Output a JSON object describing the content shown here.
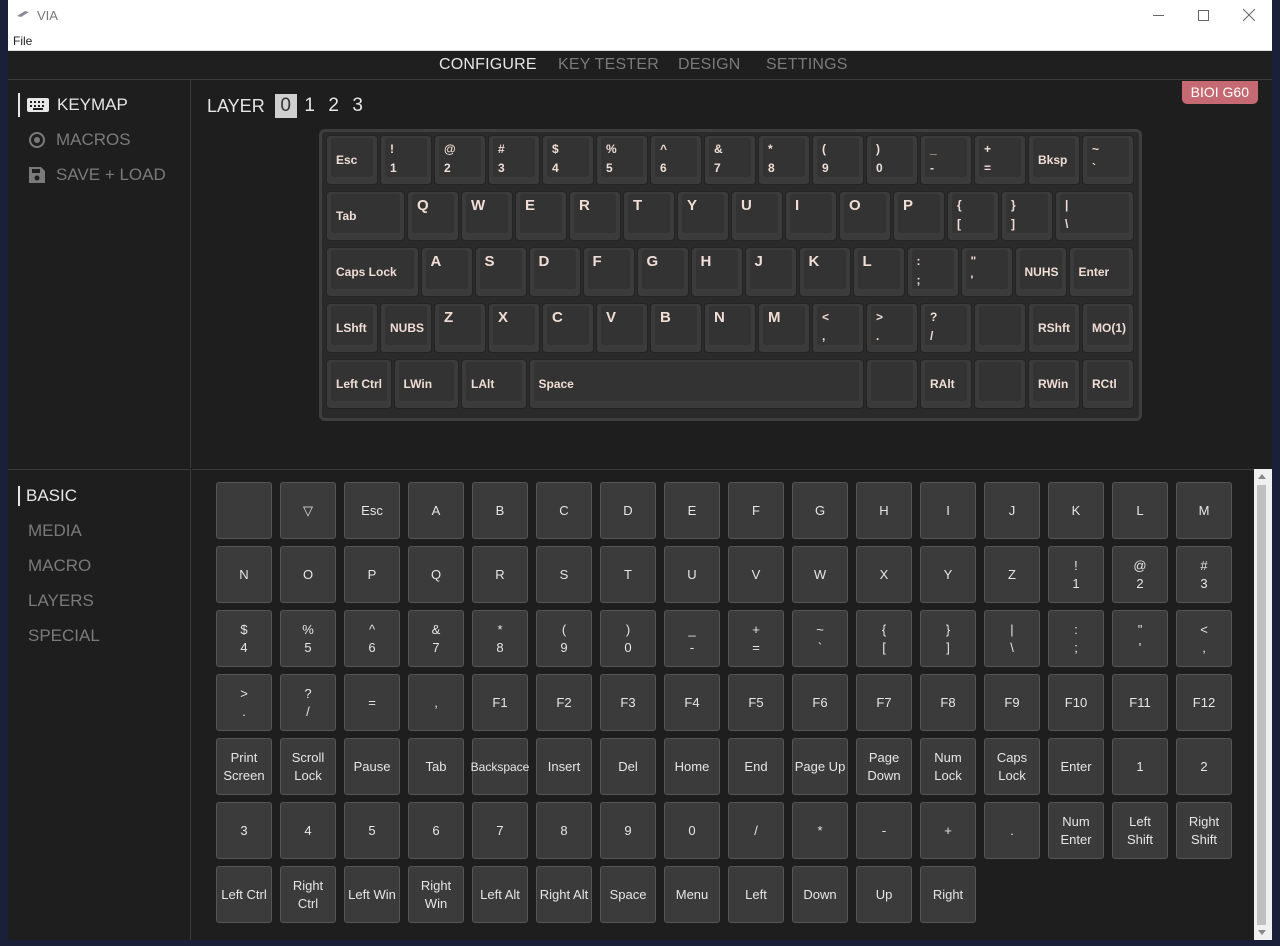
{
  "window": {
    "title": "VIA"
  },
  "menu": {
    "file": "File"
  },
  "nav": {
    "tabs": [
      "CONFIGURE",
      "KEY TESTER",
      "DESIGN",
      "SETTINGS"
    ]
  },
  "sidebar": {
    "items": [
      "KEYMAP",
      "MACROS",
      "SAVE + LOAD"
    ]
  },
  "layers": {
    "label": "LAYER",
    "options": [
      "0",
      "1",
      "2",
      "3"
    ],
    "selected": "0"
  },
  "board": {
    "name": "BIOI G60"
  },
  "keymap": {
    "rows": [
      [
        [
          "Esc",
          ""
        ],
        [
          "!",
          "1"
        ],
        [
          "@",
          "2"
        ],
        [
          "#",
          "3"
        ],
        [
          "$",
          "4"
        ],
        [
          "%",
          "5"
        ],
        [
          "^",
          "6"
        ],
        [
          "&",
          "7"
        ],
        [
          "*",
          "8"
        ],
        [
          "(",
          "9"
        ],
        [
          ")",
          "0"
        ],
        [
          "_",
          "-"
        ],
        [
          "+",
          "="
        ],
        [
          "Bksp",
          ""
        ],
        [
          "~",
          "`"
        ]
      ],
      [
        [
          "Tab",
          ""
        ],
        [
          "Q",
          ""
        ],
        [
          "W",
          ""
        ],
        [
          "E",
          ""
        ],
        [
          "R",
          ""
        ],
        [
          "T",
          ""
        ],
        [
          "Y",
          ""
        ],
        [
          "U",
          ""
        ],
        [
          "I",
          ""
        ],
        [
          "O",
          ""
        ],
        [
          "P",
          ""
        ],
        [
          "{",
          "["
        ],
        [
          "}",
          "]"
        ],
        [
          "|",
          "\\"
        ]
      ],
      [
        [
          "Caps Lock",
          ""
        ],
        [
          "A",
          ""
        ],
        [
          "S",
          ""
        ],
        [
          "D",
          ""
        ],
        [
          "F",
          ""
        ],
        [
          "G",
          ""
        ],
        [
          "H",
          ""
        ],
        [
          "J",
          ""
        ],
        [
          "K",
          ""
        ],
        [
          "L",
          ""
        ],
        [
          ":",
          ";"
        ],
        [
          "\"",
          "'"
        ],
        [
          "NUHS",
          ""
        ],
        [
          "Enter",
          ""
        ]
      ],
      [
        [
          "LShft",
          ""
        ],
        [
          "NUBS",
          ""
        ],
        [
          "Z",
          ""
        ],
        [
          "X",
          ""
        ],
        [
          "C",
          ""
        ],
        [
          "V",
          ""
        ],
        [
          "B",
          ""
        ],
        [
          "N",
          ""
        ],
        [
          "M",
          ""
        ],
        [
          "<",
          ","
        ],
        [
          ">",
          "."
        ],
        [
          "?",
          "/"
        ],
        [
          "",
          ""
        ],
        [
          "RShft",
          ""
        ],
        [
          "MO(1)",
          ""
        ]
      ],
      [
        [
          "Left Ctrl",
          ""
        ],
        [
          "LWin",
          ""
        ],
        [
          "LAlt",
          ""
        ],
        [
          "Space",
          ""
        ],
        [
          "",
          ""
        ],
        [
          "RAlt",
          ""
        ],
        [
          "",
          ""
        ],
        [
          "RWin",
          ""
        ],
        [
          "RCtl",
          ""
        ]
      ]
    ]
  },
  "categories": {
    "items": [
      "BASIC",
      "MEDIA",
      "MACRO",
      "LAYERS",
      "SPECIAL"
    ]
  },
  "palette": {
    "keys": [
      "",
      "▽",
      "Esc",
      "A",
      "B",
      "C",
      "D",
      "E",
      "F",
      "G",
      "H",
      "I",
      "J",
      "K",
      "L",
      "M",
      "N",
      "O",
      "P",
      "Q",
      "R",
      "S",
      "T",
      "U",
      "V",
      "W",
      "X",
      "Y",
      "Z",
      "!\n1",
      "@\n2",
      "#\n3",
      "$\n4",
      "%\n5",
      "^\n6",
      "&\n7",
      "*\n8",
      "(\n9",
      ")\n0",
      "_\n-",
      "+\n=",
      "~\n`",
      "{\n[",
      "}\n]",
      "|\n\\",
      ":\n;",
      "\"\n'",
      "<\n,",
      ">\n.",
      "?\n/",
      "=",
      ",",
      "F1",
      "F2",
      "F3",
      "F4",
      "F5",
      "F6",
      "F7",
      "F8",
      "F9",
      "F10",
      "F11",
      "F12",
      "Print\nScreen",
      "Scroll\nLock",
      "Pause",
      "Tab",
      "Backspace",
      "Insert",
      "Del",
      "Home",
      "End",
      "Page Up",
      "Page\nDown",
      "Num\nLock",
      "Caps\nLock",
      "Enter",
      "1",
      "2",
      "3",
      "4",
      "5",
      "6",
      "7",
      "8",
      "9",
      "0",
      "/",
      "*",
      "-",
      "+",
      ".",
      "Num\nEnter",
      "Left\nShift",
      "Right\nShift",
      "Left Ctrl",
      "Right\nCtrl",
      "Left Win",
      "Right\nWin",
      "Left Alt",
      "Right Alt",
      "Space",
      "Menu",
      "Left",
      "Down",
      "Up",
      "Right"
    ]
  },
  "colors": {
    "badge": "#c56a72",
    "keyLegend": "#f0ddd4",
    "background": "#1e1e1e"
  }
}
